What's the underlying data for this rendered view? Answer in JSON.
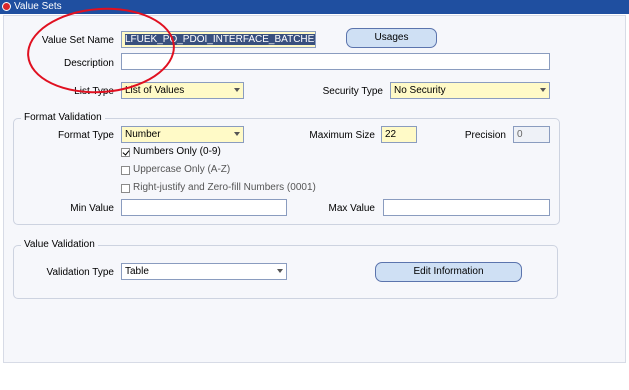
{
  "window": {
    "title": "Value Sets"
  },
  "form": {
    "value_set_name_label": "Value Set Name",
    "value_set_name": "LFUEK_PO_PDOI_INTERFACE_BATCHES",
    "usages_button": "Usages",
    "description_label": "Description",
    "description_value": "",
    "list_type_label": "List Type",
    "list_type_value": "List of Values",
    "security_type_label": "Security Type",
    "security_type_value": "No Security"
  },
  "format_validation": {
    "title": "Format Validation",
    "format_type_label": "Format Type",
    "format_type_value": "Number",
    "maximum_size_label": "Maximum Size",
    "maximum_size_value": "22",
    "precision_label": "Precision",
    "precision_value": "0",
    "numbers_only_label": "Numbers Only (0-9)",
    "numbers_only_checked": true,
    "uppercase_only_label": "Uppercase Only (A-Z)",
    "uppercase_only_checked": false,
    "right_justify_label": "Right-justify and Zero-fill Numbers (0001)",
    "right_justify_checked": false,
    "min_value_label": "Min Value",
    "min_value": "",
    "max_value_label": "Max Value",
    "max_value": ""
  },
  "value_validation": {
    "title": "Value Validation",
    "validation_type_label": "Validation Type",
    "validation_type_value": "Table",
    "edit_information_button": "Edit Information"
  },
  "colors": {
    "title_bar": "#1f4fa0",
    "required_field": "#fffac7",
    "annotation_ellipse": "#e01020"
  }
}
